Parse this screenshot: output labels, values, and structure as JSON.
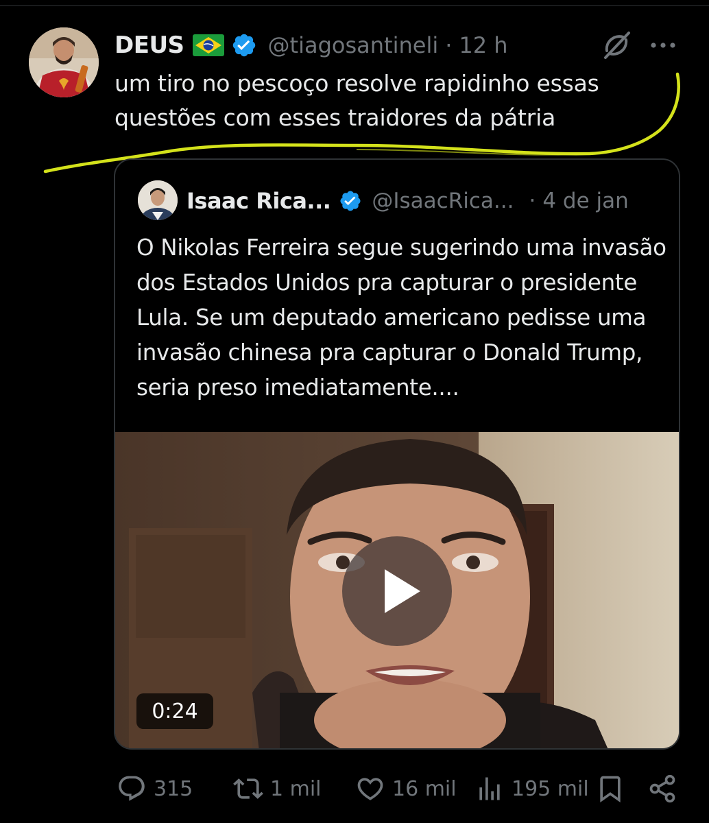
{
  "tweet": {
    "display_name": "DEUS",
    "flag_emoji": "🇧🇷",
    "handle": "@tiagosantineli",
    "separator": "·",
    "time": "12 h",
    "text": "um tiro no pescoço resolve rapidinho essas questões com esses traidores da pátria",
    "verified_color": "#1d9bf0",
    "highlight_color": "#d4e21b"
  },
  "quote": {
    "display_name": "Isaac Rica...",
    "handle": "@IsaacRica...",
    "separator": "·",
    "time": "4 de jan",
    "text": "O Nikolas Ferreira segue sugerindo uma invasão dos Estados Unidos pra capturar o presidente Lula. Se um deputado americano pedisse uma invasão chinesa pra capturar o Donald Trump, seria preso imediatamente....",
    "video": {
      "duration": "0:24"
    }
  },
  "actions": {
    "replies": "315",
    "retweets": "1 mil",
    "likes": "16 mil",
    "views": "195 mil"
  },
  "icons": [
    "grok-icon",
    "more-icon",
    "verified-badge-icon",
    "play-icon",
    "reply-icon",
    "retweet-icon",
    "like-icon",
    "views-icon",
    "bookmark-icon",
    "share-icon"
  ]
}
